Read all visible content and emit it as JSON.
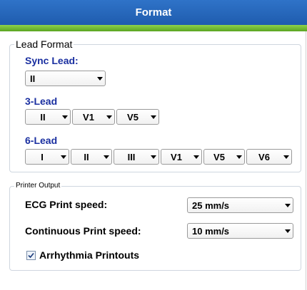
{
  "window": {
    "title": "Format"
  },
  "lead_format": {
    "legend": "Lead Format",
    "sync_lead": {
      "label": "Sync Lead:",
      "value": "II"
    },
    "three_lead": {
      "label": "3-Lead",
      "values": [
        "II",
        "V1",
        "V5"
      ]
    },
    "six_lead": {
      "label": "6-Lead",
      "values": [
        "I",
        "II",
        "III",
        "V1",
        "V5",
        "V6"
      ]
    }
  },
  "printer_output": {
    "legend": "Printer Output",
    "ecg_print_speed": {
      "label": "ECG Print speed:",
      "value": "25 mm/s"
    },
    "continuous_print_speed": {
      "label": "Continuous Print speed:",
      "value": "10 mm/s"
    },
    "arrhythmia_printouts": {
      "label": "Arrhythmia Printouts",
      "checked": true
    }
  },
  "colors": {
    "title_bar": "#2567bd",
    "accent_green": "#7cc23a",
    "section_heading": "#1a2fa0"
  }
}
